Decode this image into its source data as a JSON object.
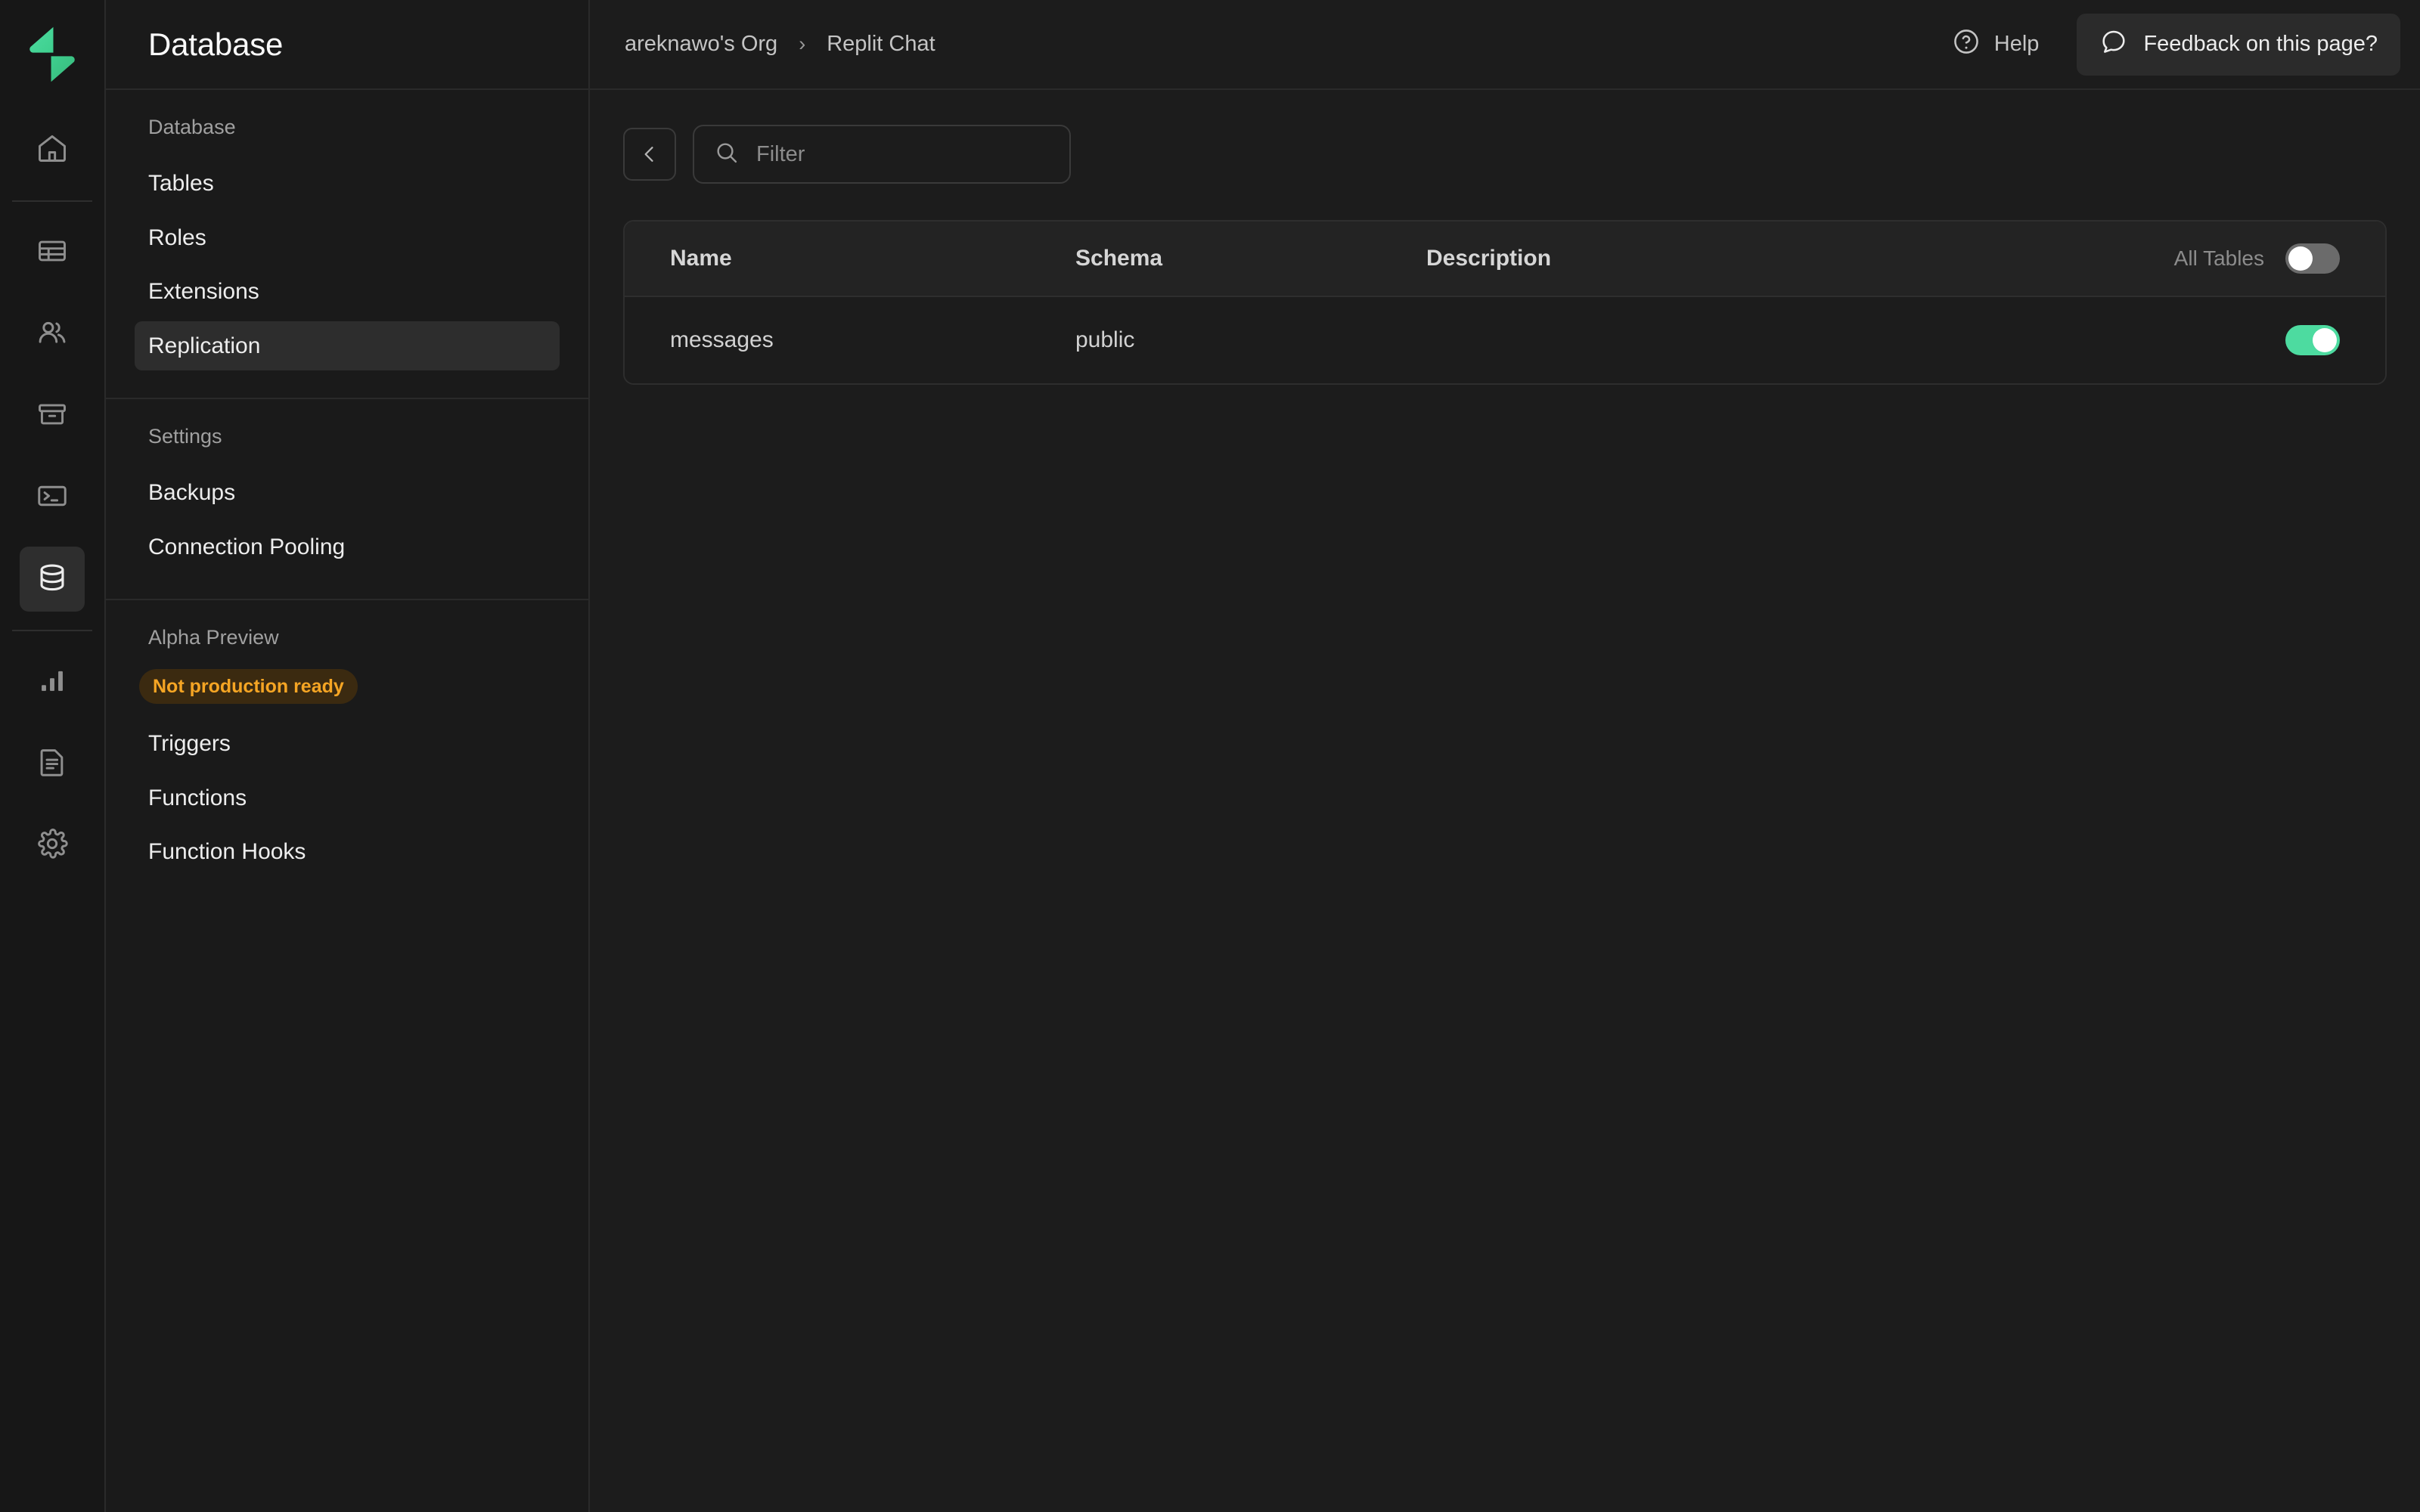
{
  "rail": {
    "logo": "supabase-lightning-logo",
    "items": [
      {
        "icon": "home-icon",
        "name": "rail-home"
      },
      {
        "icon": "table-icon",
        "name": "rail-table-editor"
      },
      {
        "icon": "users-icon",
        "name": "rail-authentication"
      },
      {
        "icon": "archive-icon",
        "name": "rail-storage"
      },
      {
        "icon": "terminal-icon",
        "name": "rail-sql-editor"
      },
      {
        "icon": "database-icon",
        "name": "rail-database",
        "active": true
      },
      {
        "icon": "bar-chart-icon",
        "name": "rail-reports"
      },
      {
        "icon": "document-icon",
        "name": "rail-logs"
      },
      {
        "icon": "gear-icon",
        "name": "rail-settings"
      }
    ]
  },
  "sidebar": {
    "title": "Database",
    "groups": [
      {
        "label": "Database",
        "items": [
          {
            "label": "Tables",
            "active": false
          },
          {
            "label": "Roles",
            "active": false
          },
          {
            "label": "Extensions",
            "active": false
          },
          {
            "label": "Replication",
            "active": true
          }
        ]
      },
      {
        "label": "Settings",
        "items": [
          {
            "label": "Backups",
            "active": false
          },
          {
            "label": "Connection Pooling",
            "active": false
          }
        ]
      },
      {
        "label": "Alpha Preview",
        "badge": "Not production ready",
        "items": [
          {
            "label": "Triggers",
            "active": false
          },
          {
            "label": "Functions",
            "active": false
          },
          {
            "label": "Function Hooks",
            "active": false
          }
        ]
      }
    ]
  },
  "topbar": {
    "breadcrumb": [
      "areknawo's Org",
      "Replit Chat"
    ],
    "separator": "›",
    "help_label": "Help",
    "feedback_label": "Feedback on this page?"
  },
  "toolbar": {
    "back_label": "‹",
    "filter_placeholder": "Filter",
    "filter_value": ""
  },
  "table": {
    "columns": [
      "Name",
      "Schema",
      "Description"
    ],
    "all_tables_label": "All Tables",
    "all_tables_enabled": false,
    "rows": [
      {
        "name": "messages",
        "schema": "public",
        "description": "",
        "enabled": true
      }
    ]
  },
  "colors": {
    "accent_green": "#4ddba0",
    "badge_text": "#f5a524",
    "badge_bg": "#3b2a10",
    "toggle_off": "#6b6b6b"
  }
}
